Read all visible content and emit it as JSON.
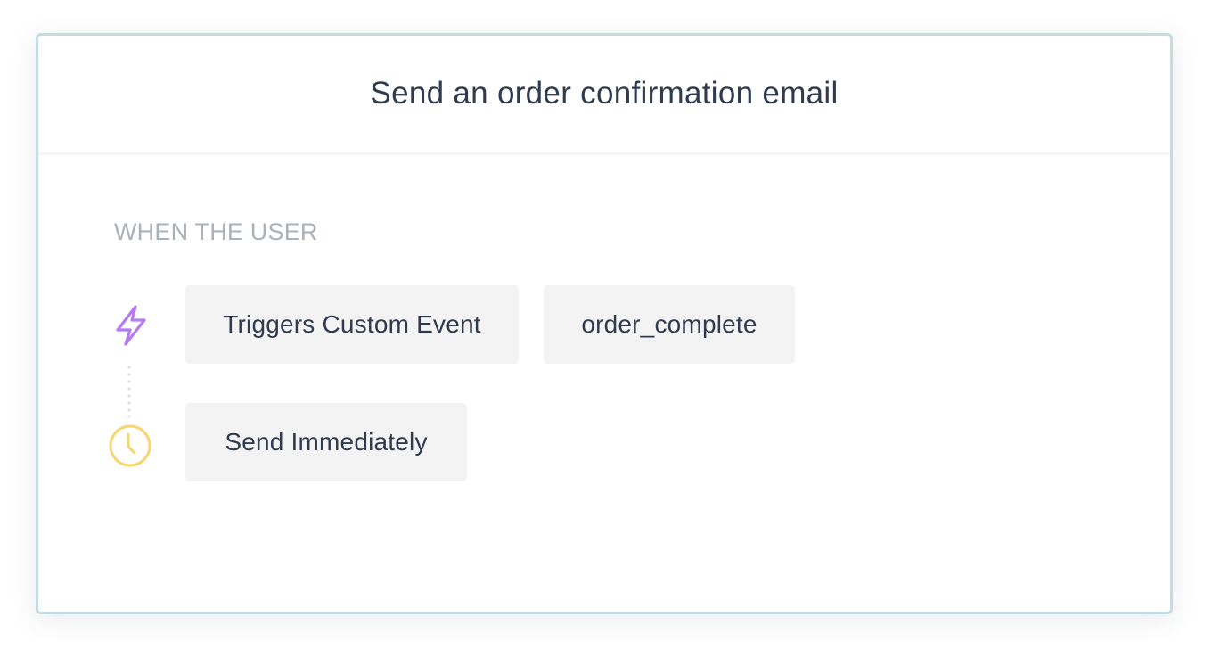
{
  "card": {
    "title": "Send an order confirmation email"
  },
  "condition": {
    "section_label": "WHEN THE USER",
    "trigger_label": "Triggers Custom Event",
    "event_name": "order_complete",
    "timing_label": "Send Immediately"
  },
  "icons": {
    "trigger": "lightning-bolt-icon",
    "timing": "clock-icon"
  },
  "colors": {
    "card_border": "#c3dce3",
    "title_text": "#2f3b4e",
    "section_label_text": "#aab1bb",
    "pill_background": "#f3f3f4",
    "bolt_icon": "#b57bf0",
    "clock_icon": "#f8d66e"
  }
}
